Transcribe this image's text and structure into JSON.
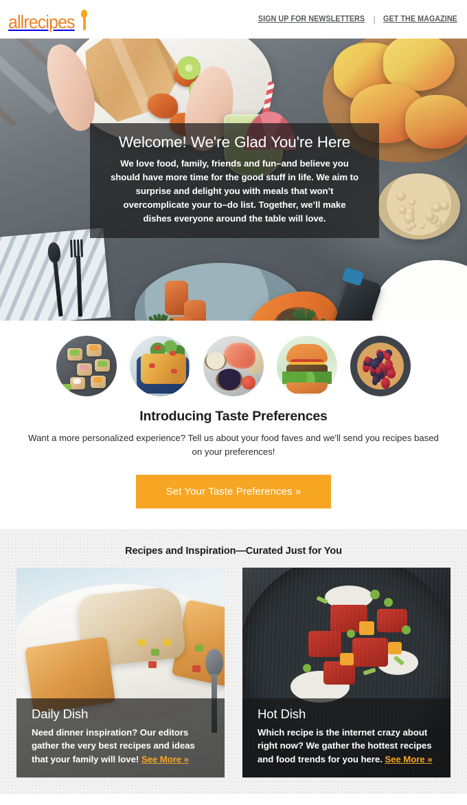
{
  "header": {
    "logo_text": "allrecipes",
    "logo_icon": "spoon-icon",
    "links": [
      {
        "label": "SIGN UP FOR NEWSLETTERS"
      },
      {
        "label": "GET THE MAGAZINE"
      }
    ],
    "separator": "|",
    "brand_color": "#F07F24"
  },
  "hero": {
    "title": "Welcome! We're Glad You're Here",
    "body": "We love food, family, friends and fun–and believe you should have more time for the good stuff in life. We aim to surprise and delight you with meals that won’t overcomplicate your to–do list. Together, we’ll make dishes everyone around the table will love.",
    "photo_alt": "overhead-table-spread-photo"
  },
  "preferences": {
    "circles": [
      {
        "name": "canapes-appetizers-thumb"
      },
      {
        "name": "casserole-dish-thumb"
      },
      {
        "name": "salmon-blueberries-thumb"
      },
      {
        "name": "veggie-burger-thumb"
      },
      {
        "name": "berry-tart-thumb"
      }
    ],
    "heading": "Introducing Taste Preferences",
    "description": "Want a more personalized experience? Tell us about your food faves and we'll send you recipes based on your preferences!",
    "cta_label": "Set Your Taste Preferences »",
    "cta_color": "#F6A623"
  },
  "curated": {
    "heading": "Recipes and Inspiration—Curated Just for You",
    "cards": [
      {
        "title": "Daily Dish",
        "body": "Need dinner inspiration? Our editors gather the very best recipes and ideas that your family will love!",
        "link_label": "See More »",
        "photo_alt": "chicken-and-toast-plate-photo"
      },
      {
        "title": "Hot Dish",
        "body": "Which recipe is the internet crazy about right now? We gather the hottest recipes and food trends for you here.",
        "link_label": "See More »",
        "photo_alt": "poke-bowl-dark-pan-photo"
      }
    ],
    "link_color": "#F6A623",
    "background_color": "#F2F2F2"
  }
}
